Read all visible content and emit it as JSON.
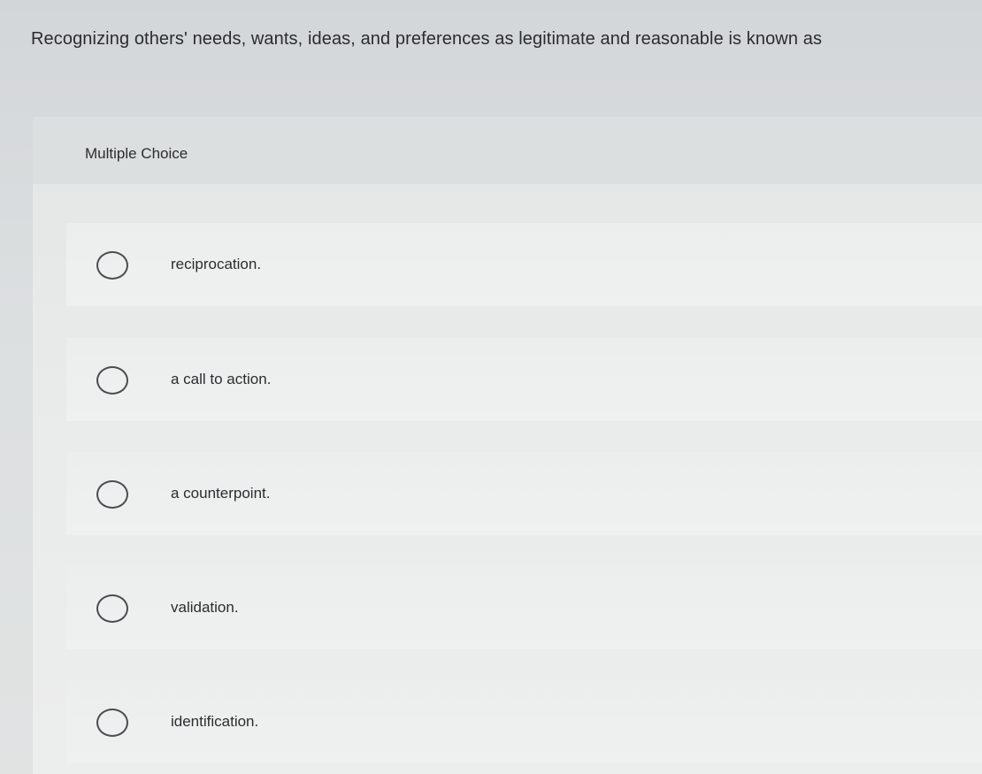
{
  "question": {
    "text": "Recognizing others' needs, wants, ideas, and preferences as legitimate and reasonable is known as"
  },
  "card": {
    "type_label": "Multiple Choice",
    "options": [
      {
        "label": "reciprocation.",
        "selected": false
      },
      {
        "label": "a call to action.",
        "selected": false
      },
      {
        "label": "a counterpoint.",
        "selected": false
      },
      {
        "label": "validation.",
        "selected": false
      },
      {
        "label": "identification.",
        "selected": false
      }
    ]
  },
  "colors": {
    "background": "#dcdfe0",
    "card": "#eaebeb",
    "text": "#2b2d2f",
    "radio_border": "#4a4d50"
  }
}
